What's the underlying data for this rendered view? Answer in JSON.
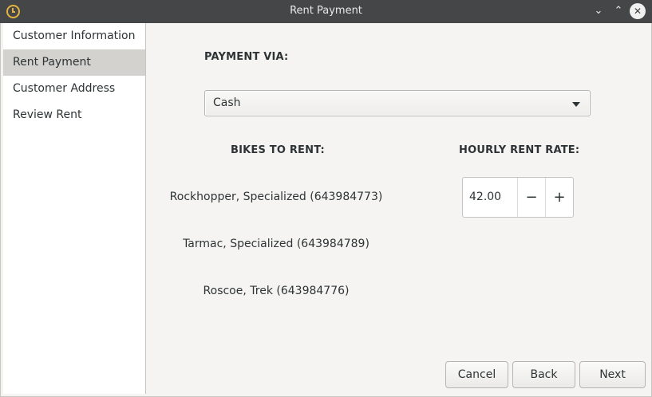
{
  "window": {
    "title": "Rent Payment"
  },
  "sidebar": {
    "items": [
      {
        "label": "Customer Information"
      },
      {
        "label": "Rent Payment"
      },
      {
        "label": "Customer Address"
      },
      {
        "label": "Review Rent"
      }
    ],
    "selected": "Rent Payment"
  },
  "payment": {
    "heading": "PAYMENT VIA:",
    "selected_option": "Cash"
  },
  "bikes": {
    "heading": "BIKES TO RENT:",
    "items": [
      {
        "label": "Rockhopper, Specialized (643984773)"
      },
      {
        "label": "Tarmac, Specialized (643984789)"
      },
      {
        "label": "Roscoe, Trek (643984776)"
      }
    ]
  },
  "rate": {
    "heading": "HOURLY RENT RATE:",
    "value": "42.00",
    "decrement_symbol": "−",
    "increment_symbol": "+"
  },
  "footer": {
    "cancel_label": "Cancel",
    "back_label": "Back",
    "next_label": "Next"
  },
  "icons": {
    "app": "clock-icon",
    "minimize": "chevron-down-icon",
    "maximize": "chevron-up-icon",
    "close": "close-icon"
  },
  "colors": {
    "titlebar": "#444648",
    "selection": "#d3d2cf",
    "app_icon": "#e3b341"
  }
}
